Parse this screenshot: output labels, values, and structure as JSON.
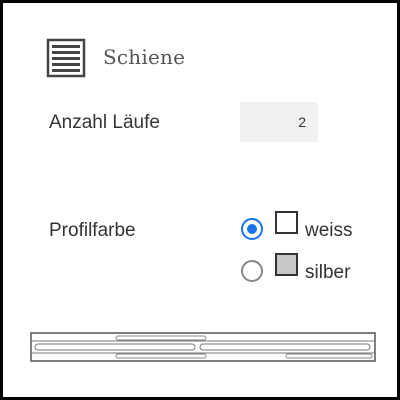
{
  "panel": {
    "title": "Schiene",
    "icon": "rail-lines-icon"
  },
  "runs": {
    "label": "Anzahl Läufe",
    "value": "2"
  },
  "profile_color": {
    "label": "Profilfarbe",
    "selected": "weiss",
    "options": [
      {
        "label": "weiss",
        "swatch_color": "#ffffff",
        "checked": true
      },
      {
        "label": "silber",
        "swatch_color": "#c8c8c8",
        "checked": false
      }
    ]
  },
  "colors": {
    "accent": "#1a73e8",
    "input_bg": "#f1f1f1",
    "frame_border": "#000000"
  }
}
